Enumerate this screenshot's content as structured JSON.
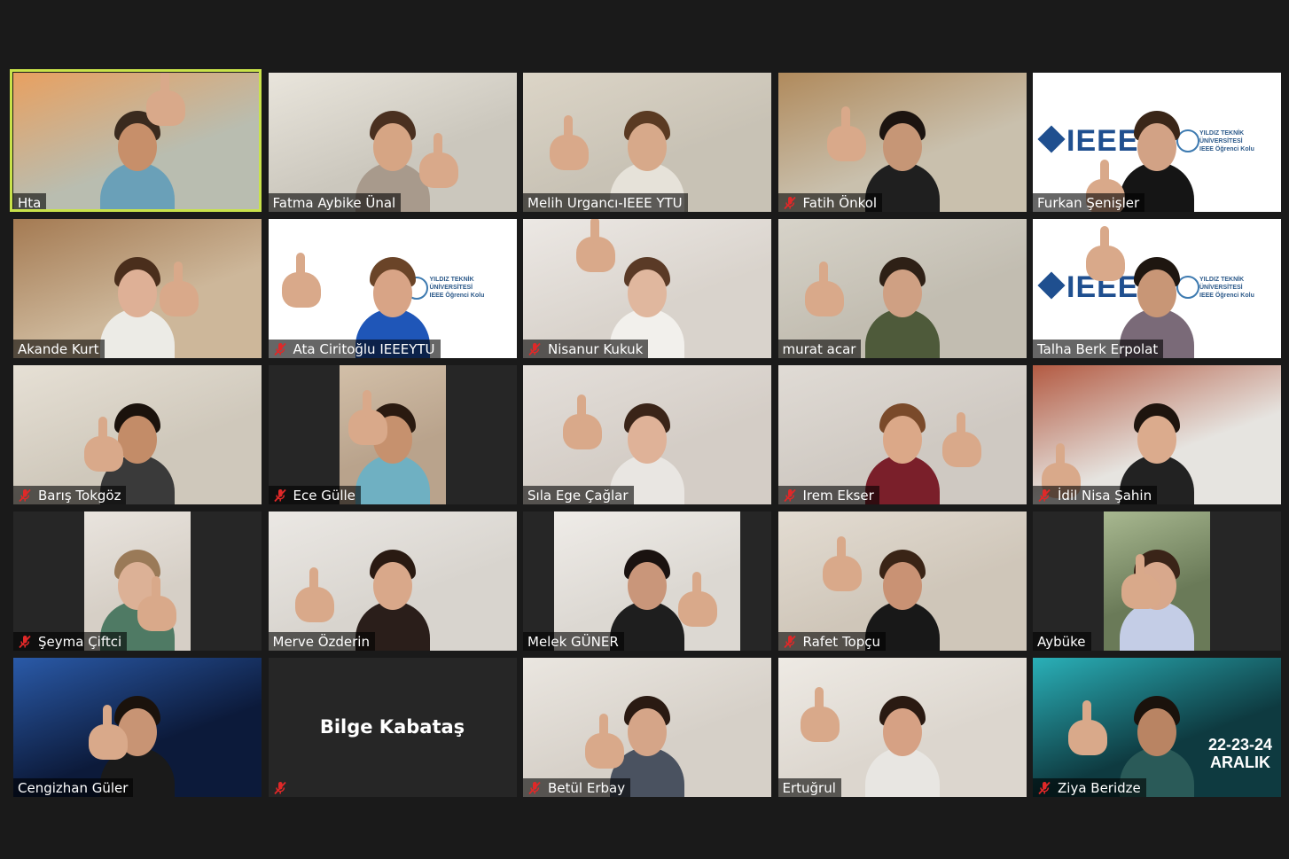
{
  "app": {
    "background": "#1a1a1a",
    "speaker_highlight_color": "#c9e24a",
    "muted_icon_color": "#e02828"
  },
  "participants": [
    {
      "name": "Hta",
      "muted": false,
      "active_speaker": true,
      "video": "full",
      "bg": "#b9bdb0",
      "accent": "#e8a060",
      "shirt": "#6aa0b8",
      "skin": "#c78f6a",
      "hair": "#3a2a1e"
    },
    {
      "name": "Fatma Aybike Ünal",
      "muted": false,
      "active_speaker": false,
      "video": "full",
      "bg": "#cbc7bd",
      "accent": "#e9e5dc",
      "shirt": "#a89a8c",
      "skin": "#d6a584",
      "hair": "#4a3020"
    },
    {
      "name": "Melih Urgancı-IEEE YTU",
      "muted": false,
      "active_speaker": false,
      "video": "full",
      "bg": "#c8c2b5",
      "accent": "#dcd5c7",
      "shirt": "#e6e2d9",
      "skin": "#d7a98a",
      "hair": "#5a3a22"
    },
    {
      "name": "Fatih Önkol",
      "muted": true,
      "active_speaker": false,
      "video": "full",
      "bg": "#c9c0ad",
      "accent": "#b08a5c",
      "shirt": "#1f1f1f",
      "skin": "#c69676",
      "hair": "#1c1410"
    },
    {
      "name": "Furkan Şenişler",
      "muted": false,
      "active_speaker": false,
      "video": "full",
      "bg": "#ffffff",
      "accent": "#ffffff",
      "shirt": "#151515",
      "skin": "#d2a285",
      "hair": "#3a2618",
      "ieee_logo": "IEEE",
      "ytu_caption": [
        "YILDIZ TEKNİK",
        "ÜNİVERSİTESİ",
        "IEEE Öğrenci Kolu"
      ]
    },
    {
      "name": "Akande Kurt",
      "muted": false,
      "active_speaker": false,
      "video": "full",
      "bg": "#cdb79a",
      "accent": "#a47a52",
      "shirt": "#ecebe6",
      "skin": "#deb096",
      "hair": "#4a2e1c"
    },
    {
      "name": "Ata Ciritoğlu IEEEYTU",
      "muted": true,
      "active_speaker": false,
      "video": "full",
      "bg": "#ffffff",
      "accent": "#ffffff",
      "shirt": "#1f56b8",
      "skin": "#d8a486",
      "hair": "#6a4428",
      "ytu_caption": [
        "YILDIZ TEKNİK",
        "ÜNİVERSİTESİ",
        "IEEE Öğrenci Kolu"
      ]
    },
    {
      "name": "Nisanur Kukuk",
      "muted": true,
      "active_speaker": false,
      "video": "full",
      "bg": "#d9d3cc",
      "accent": "#ece8e4",
      "shirt": "#f2f0ec",
      "skin": "#e0b79e",
      "hair": "#5a3a26"
    },
    {
      "name": "murat acar",
      "muted": false,
      "active_speaker": false,
      "video": "full",
      "bg": "#c2bdb1",
      "accent": "#d7d3c9",
      "shirt": "#4e5a3a",
      "skin": "#cfa083",
      "hair": "#2e2016"
    },
    {
      "name": "Talha Berk Erpolat",
      "muted": false,
      "active_speaker": false,
      "video": "full",
      "bg": "#ffffff",
      "accent": "#ffffff",
      "shirt": "#7a6a78",
      "skin": "#c89676",
      "hair": "#1e1610",
      "ieee_logo": "IEEE",
      "ytu_caption": [
        "YILDIZ TEKNİK",
        "ÜNİVERSİTESİ",
        "IEEE Öğrenci Kolu"
      ]
    },
    {
      "name": "Barış Tokgöz",
      "muted": true,
      "active_speaker": false,
      "video": "full",
      "bg": "#cfc8bb",
      "accent": "#e6e0d5",
      "shirt": "#3a3a3a",
      "skin": "#c38c68",
      "hair": "#1a120c"
    },
    {
      "name": "Ece Gülle",
      "muted": true,
      "active_speaker": false,
      "video": "narrow",
      "bg": "#b9a38c",
      "accent": "#d2bfa8",
      "shirt": "#6fb0c2",
      "skin": "#c6916e",
      "hair": "#2a1a10"
    },
    {
      "name": "Sıla Ege Çağlar",
      "muted": false,
      "active_speaker": false,
      "video": "full",
      "bg": "#d4cdc6",
      "accent": "#e4dfda",
      "shirt": "#e9e6e2",
      "skin": "#dfb298",
      "hair": "#3a2418"
    },
    {
      "name": "Irem Ekser",
      "muted": true,
      "active_speaker": false,
      "video": "full",
      "bg": "#cfc9c2",
      "accent": "#e0dbd5",
      "shirt": "#7a1f2a",
      "skin": "#dba888",
      "hair": "#7a4a2a"
    },
    {
      "name": "İdil Nisa Şahin",
      "muted": true,
      "active_speaker": false,
      "video": "full",
      "bg": "#e6e4e0",
      "accent": "#b35a42",
      "shirt": "#222222",
      "skin": "#dbab8d",
      "hair": "#1e140e"
    },
    {
      "name": "Şeyma Çiftci",
      "muted": true,
      "active_speaker": false,
      "video": "narrow",
      "bg": "#d6cfc6",
      "accent": "#e9e4de",
      "shirt": "#4f7a64",
      "skin": "#dcb196",
      "hair": "#9a7a58"
    },
    {
      "name": "Merve Özderin",
      "muted": false,
      "active_speaker": false,
      "video": "full",
      "bg": "#d8d4ce",
      "accent": "#ebe8e4",
      "shirt": "#2a1e1a",
      "skin": "#d9a88a",
      "hair": "#2a1a12"
    },
    {
      "name": "Melek GÜNER",
      "muted": false,
      "active_speaker": false,
      "video": "mid",
      "bg": "#dcd8d2",
      "accent": "#efece8",
      "shirt": "#1e1e1e",
      "skin": "#c9967a",
      "hair": "#1a1210"
    },
    {
      "name": "Rafet Topçu",
      "muted": true,
      "active_speaker": false,
      "video": "full",
      "bg": "#cfc6b9",
      "accent": "#e3dcd2",
      "shirt": "#181818",
      "skin": "#c99274",
      "hair": "#3a2416"
    },
    {
      "name": "Aybüke",
      "muted": false,
      "active_speaker": false,
      "video": "narrow",
      "bg": "#6a7a58",
      "accent": "#a8b890",
      "shirt": "#c4cde6",
      "skin": "#d8a88c",
      "hair": "#3a2418"
    },
    {
      "name": "Cengizhan Güler",
      "muted": false,
      "active_speaker": false,
      "video": "full",
      "bg": "#0c1a3a",
      "accent": "#2a5aa8",
      "shirt": "#1a1a1a",
      "skin": "#c89474",
      "hair": "#1a120c"
    },
    {
      "name": "Bilge Kabataş",
      "muted": true,
      "active_speaker": false,
      "video": "off",
      "bg": "#262626"
    },
    {
      "name": "Betül Erbay",
      "muted": true,
      "active_speaker": false,
      "video": "full",
      "bg": "#d6d0c8",
      "accent": "#eae6e0",
      "shirt": "#4a5260",
      "skin": "#d5a588",
      "hair": "#2a1a12"
    },
    {
      "name": "Ertuğrul",
      "muted": false,
      "active_speaker": false,
      "video": "full",
      "bg": "#dcd6ce",
      "accent": "#eeeae4",
      "shirt": "#e8e6e2",
      "skin": "#d6a184",
      "hair": "#2a1a12"
    },
    {
      "name": "Ziya Beridze",
      "muted": true,
      "active_speaker": false,
      "video": "full",
      "bg": "#0e3a40",
      "accent": "#2ab0b8",
      "shirt": "#2a5a58",
      "skin": "#b98463",
      "hair": "#1a120c",
      "event_date": [
        "22-23-24",
        "ARALIK"
      ]
    }
  ]
}
